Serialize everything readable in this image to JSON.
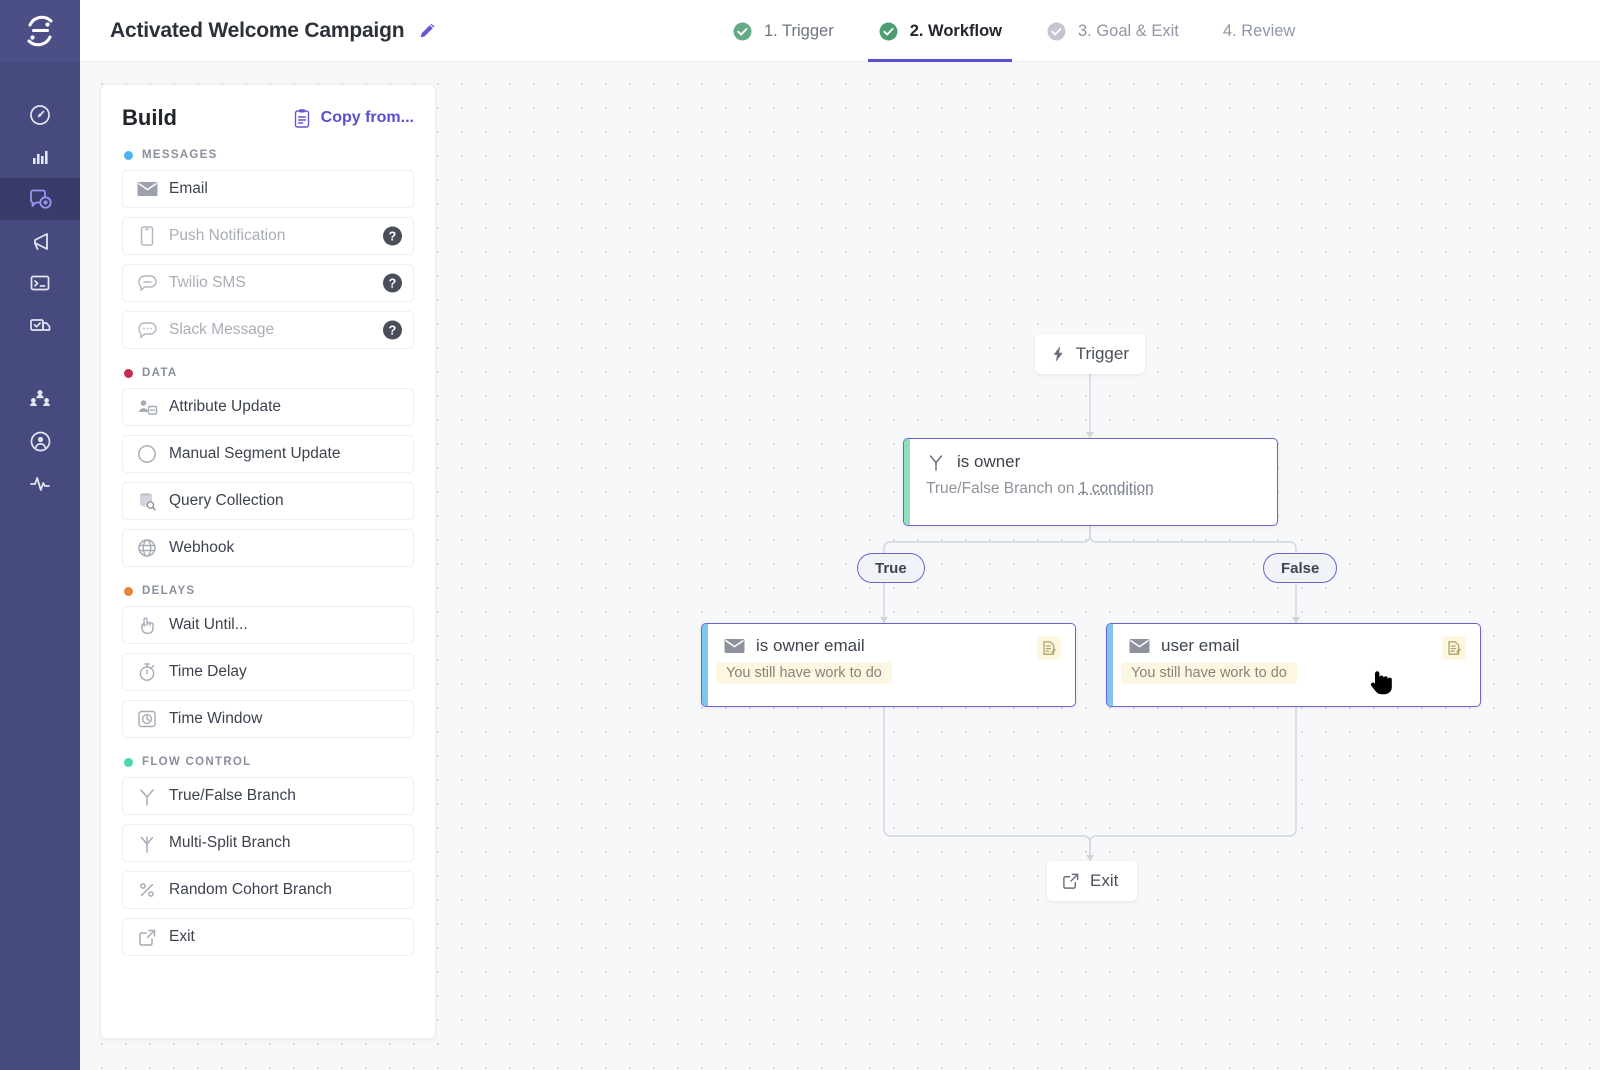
{
  "app": {
    "logo_icon": "sendgrid-swirl-logo-icon"
  },
  "topbar": {
    "campaign_title": "Activated Welcome Campaign",
    "edit_icon": "pencil-icon",
    "steps": [
      {
        "label": "1. Trigger",
        "state": "done",
        "icon": "check-circle-icon"
      },
      {
        "label": "2. Workflow",
        "state": "current",
        "icon": "check-circle-icon"
      },
      {
        "label": "3. Goal & Exit",
        "state": "pending",
        "icon": "check-circle-icon"
      },
      {
        "label": "4. Review",
        "state": "pending",
        "icon": "none"
      }
    ]
  },
  "rail": {
    "items": [
      {
        "name": "dashboard",
        "icon": "gauge-icon",
        "active": false
      },
      {
        "name": "analytics",
        "icon": "bar-chart-icon",
        "active": false
      },
      {
        "name": "campaigns",
        "icon": "campaign-icon",
        "active": true
      },
      {
        "name": "broadcasts",
        "icon": "megaphone-icon",
        "active": false
      },
      {
        "name": "console",
        "icon": "terminal-icon",
        "active": false
      },
      {
        "name": "deliveries",
        "icon": "delivery-truck-icon",
        "active": false
      },
      {
        "name": "people",
        "icon": "people-group-icon",
        "active": false
      },
      {
        "name": "account",
        "icon": "person-circle-icon",
        "active": false
      },
      {
        "name": "activity",
        "icon": "activity-pulse-icon",
        "active": false
      }
    ]
  },
  "build_panel": {
    "title": "Build",
    "copy_from_label": "Copy from...",
    "copy_from_icon": "clipboard-icon",
    "groups": [
      {
        "name": "MESSAGES",
        "dot_color": "#4ab4f0",
        "blocks": [
          {
            "label": "Email",
            "icon": "envelope-icon",
            "disabled": false,
            "help": false
          },
          {
            "label": "Push Notification",
            "icon": "mobile-phone-icon",
            "disabled": true,
            "help": true
          },
          {
            "label": "Twilio SMS",
            "icon": "chat-bubble-icon",
            "disabled": true,
            "help": true
          },
          {
            "label": "Slack Message",
            "icon": "chat-dots-icon",
            "disabled": true,
            "help": true
          }
        ]
      },
      {
        "name": "DATA",
        "dot_color": "#c62b52",
        "blocks": [
          {
            "label": "Attribute Update",
            "icon": "person-card-icon",
            "disabled": false,
            "help": false
          },
          {
            "label": "Manual Segment Update",
            "icon": "compass-icon",
            "disabled": false,
            "help": false
          },
          {
            "label": "Query Collection",
            "icon": "database-search-icon",
            "disabled": false,
            "help": false
          },
          {
            "label": "Webhook",
            "icon": "globe-icon",
            "disabled": false,
            "help": false
          }
        ]
      },
      {
        "name": "DELAYS",
        "dot_color": "#e8833a",
        "blocks": [
          {
            "label": "Wait Until...",
            "icon": "hand-pause-icon",
            "disabled": false,
            "help": false
          },
          {
            "label": "Time Delay",
            "icon": "stopwatch-icon",
            "disabled": false,
            "help": false
          },
          {
            "label": "Time Window",
            "icon": "clock-box-icon",
            "disabled": false,
            "help": false
          }
        ]
      },
      {
        "name": "FLOW CONTROL",
        "dot_color": "#49d8b0",
        "blocks": [
          {
            "label": "True/False Branch",
            "icon": "branch-two-icon",
            "disabled": false,
            "help": false
          },
          {
            "label": "Multi-Split Branch",
            "icon": "branch-multi-icon",
            "disabled": false,
            "help": false
          },
          {
            "label": "Random Cohort Branch",
            "icon": "percent-icon",
            "disabled": false,
            "help": false
          },
          {
            "label": "Exit",
            "icon": "exit-arrow-icon",
            "disabled": false,
            "help": false
          }
        ]
      }
    ],
    "help_badge_label": "?"
  },
  "flow": {
    "trigger": {
      "label": "Trigger",
      "icon": "lightning-bolt-icon"
    },
    "branch": {
      "title": "is owner",
      "icon": "branch-two-icon",
      "subtitle_prefix": "True/False Branch on ",
      "subtitle_link": "1 condition",
      "accent_color": "#8fe0bd"
    },
    "pills": {
      "true_label": "True",
      "false_label": "False"
    },
    "email_true": {
      "title": "is owner email",
      "icon": "envelope-icon",
      "warning": "You still have work to do",
      "badge_icon": "document-edit-icon",
      "accent_color": "#7fc6ef"
    },
    "email_false": {
      "title": "user email",
      "icon": "envelope-icon",
      "warning": "You still have work to do",
      "badge_icon": "document-edit-icon",
      "accent_color": "#7fc6ef"
    },
    "exit": {
      "label": "Exit",
      "icon": "exit-arrow-icon"
    },
    "cursor_icon": "pointing-hand-cursor"
  },
  "colors": {
    "rail_bg": "#474a7e",
    "accent_purple": "#5a4fcf",
    "node_border": "#6b63cf",
    "canvas_bg": "#f7f8fa",
    "step_done_check": "#63ab84",
    "step_pending_check": "#bcc0c9"
  }
}
